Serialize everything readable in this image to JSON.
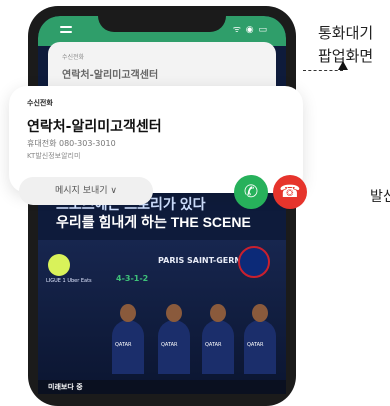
{
  "phone": {
    "status_icons": "ᯤ ◉ ▭",
    "bg_notification": {
      "label": "수신전화",
      "caller": "연락처-알리미고객센터"
    }
  },
  "popup": {
    "label": "수신전화",
    "caller": "연락처-알리미고객센터",
    "number": "휴대전화 080-303-3010",
    "carrier": "KT발신정보알리미",
    "message_button": "메시지 보내기 ∨",
    "accept_icon": "phone-accept-icon",
    "decline_icon": "phone-decline-icon"
  },
  "banner": {
    "line1": "스포츠에는 스토리가 있다",
    "line2": "우리를 힘내게 하는 THE SCENE"
  },
  "poster": {
    "team": "PARIS SAINT-GERMAIN",
    "formation": "4-3-1-2",
    "league": "LIGUE 1\nUber Eats",
    "sponsor": "QATAR",
    "ticker": "미래보다 중"
  },
  "annotations": {
    "right_top_1": "통화대기",
    "right_top_2": "팝업화면",
    "right_mid": "발신"
  },
  "colors": {
    "accept": "#27b15b",
    "decline": "#e6342c",
    "status_bar": "#2f9e6a"
  }
}
